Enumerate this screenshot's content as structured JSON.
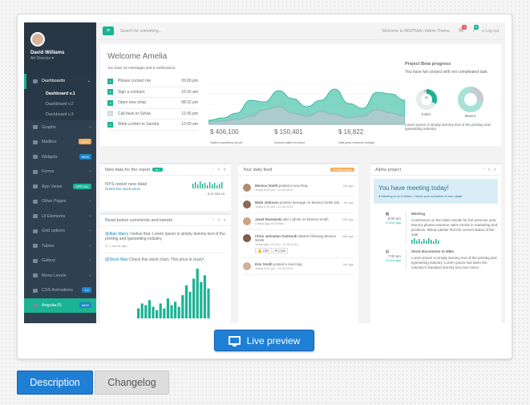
{
  "sidebar": {
    "user_name": "David Williams",
    "user_role": "Art Director ▾",
    "items": [
      {
        "label": "Dashboards",
        "active": true
      },
      {
        "label": "Dashboard v.1",
        "sub": true,
        "on": true
      },
      {
        "label": "Dashboard v.2",
        "sub": true
      },
      {
        "label": "Dashboard v.3",
        "sub": true
      },
      {
        "label": "Graphs"
      },
      {
        "label": "Mailbox",
        "badge": "16/24",
        "badge_color": "#f8ac59"
      },
      {
        "label": "Widgets",
        "badge": "NEW",
        "badge_color": "#1c84c6"
      },
      {
        "label": "Forms"
      },
      {
        "label": "App Views",
        "badge": "SPECIAL",
        "badge_color": "#1ab394"
      },
      {
        "label": "Other Pages"
      },
      {
        "label": "UI Elements"
      },
      {
        "label": "Grid options"
      },
      {
        "label": "Tables"
      },
      {
        "label": "Gallery"
      },
      {
        "label": "Menu Levels"
      },
      {
        "label": "CSS Animations",
        "badge": "1/2",
        "badge_color": "#1c84c6"
      },
      {
        "label": "AngularJS",
        "badge": "NEW",
        "badge_color": "#1c84c6",
        "angular": true
      }
    ]
  },
  "topbar": {
    "search_placeholder": "Search for something...",
    "welcome": "Welcome to INSPINIA+ Admin Theme.",
    "mail_count": "4",
    "bell_count": "8",
    "logout": "Log out"
  },
  "hero": {
    "title": "Welcome Amelia",
    "subtitle": "You have 42 messages and 6 notifications.",
    "tasks": [
      {
        "n": "1",
        "label": "Please contact me",
        "time": "09:00 pm"
      },
      {
        "n": "2",
        "label": "Sign a contract",
        "time": "10:16 am"
      },
      {
        "n": "3",
        "label": "Open new shop",
        "time": "08:22 pm"
      },
      {
        "n": "4",
        "label": "Call back to Sylvia",
        "time": "11:06 pm"
      },
      {
        "n": "5",
        "label": "Write a letter to Sandra",
        "time": "12:00 am"
      }
    ],
    "stats": [
      {
        "value": "$ 406,100",
        "label": "Sales marketing report"
      },
      {
        "value": "$ 150,401",
        "label": "Annual sales revenue"
      },
      {
        "value": "$ 16,822",
        "label": "Half-year revenue margin"
      }
    ],
    "project_title": "Project Beta progress",
    "project_text": "You have two project with not compleated task.",
    "pie1_label": "Kolter",
    "pie1_top": "300",
    "pie1_mid": "50",
    "pie2_label": "Maxtor",
    "project_foot": "Lorem Ipsum is simply dummy text of the printing and typesetting industry."
  },
  "chart_data": {
    "type": "area",
    "series": [
      {
        "values": [
          5,
          8,
          14,
          30,
          28,
          42,
          32,
          22,
          30,
          44,
          26,
          20,
          40,
          38,
          30
        ]
      },
      {
        "values": [
          3,
          4,
          6,
          10,
          18,
          22,
          14,
          10,
          16,
          12,
          8,
          10,
          18,
          14,
          10
        ]
      }
    ],
    "colors": [
      "#1ab394",
      "#bdc7d0"
    ],
    "ylim": [
      0,
      50
    ]
  },
  "panels": {
    "newdata_title": "New data for the report",
    "newdata_badge": "IN+",
    "nys_title": "NYS report new data!",
    "nys_link": "Check the stock price!",
    "nys_value": "$ 20 054.43",
    "comments_title": "Read below comments and tweets",
    "c1_user": "@Alan Marry",
    "c1_text": " I belive that. Lorem Ipsum is simply dummy text of the printing and typesetting industry.",
    "c1_time": "1 minuts ago",
    "c2_user": "@Stock Man",
    "c2_text": " Check this stock chart. This price is crazy!",
    "bars": [
      6,
      9,
      8,
      11,
      7,
      5,
      9,
      6,
      12,
      8,
      10,
      7,
      14,
      20,
      16,
      24,
      30,
      22,
      26,
      18
    ],
    "feed_title": "Your daily feed",
    "feed_badge": "10 Messages",
    "feed": [
      {
        "name": "Monica Smith",
        "text": " posted a new blog.",
        "time": "Today 5:60 pm - 12.06.2014",
        "ago": "5m ago"
      },
      {
        "name": "Mark Johnson",
        "text": " posted message on Monica Smith site.",
        "time": "Today 2:10 pm - 12.06.2014",
        "ago": "2h ago"
      },
      {
        "name": "Janet Rosowski",
        "text": " add 1 photo on Monica Smith.",
        "time": "2 days ago at 8:30am",
        "ago": "23h ago"
      },
      {
        "name": "Chris Johnatan Overtunk",
        "text": " started following Monica Smith.",
        "time": "Yesterday 1:21 pm - 11.06.2014",
        "ago": "46h ago"
      },
      {
        "name": "Kim Smith",
        "text": " posted a new blog.",
        "time": "Today 5:60 pm - 12.06.2014",
        "ago": "5m ago"
      }
    ],
    "like": "Like",
    "love": "Love",
    "alpha_title": "Alpha project",
    "alert_title": "You have meeting today!",
    "alert_sub": "Meeting is on 6:00am. Check your schedule to see detail.",
    "tl1_time": "6:00 am",
    "tl1_ago": "2 hour ago",
    "tl1_title": "Meeting",
    "tl1_text": "Conference on the sales results for the previous year. Monica please examine sales trends in marketing and products. Below please find the current status of the sale.",
    "tl2_time": "7:00 am",
    "tl2_ago": "3 hour ago",
    "tl2_title": "Send documents to Mike",
    "tl2_text": "Lorem Ipsum is simply dummy text of the printing and typesetting industry. Lorem Ipsum has been the industry's standard dummy text ever since..."
  },
  "buttons": {
    "live_preview": "Live preview",
    "description": "Description",
    "changelog": "Changelog"
  }
}
